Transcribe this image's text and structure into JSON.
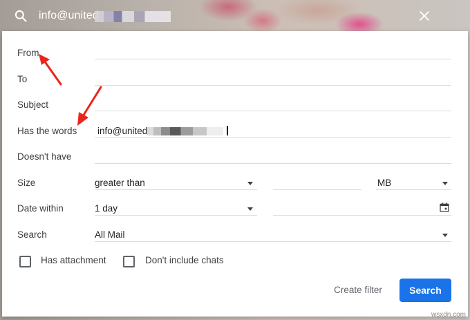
{
  "search_bar": {
    "query": "info@united",
    "icon": "search-icon",
    "close": "close-icon"
  },
  "form": {
    "from_label": "From",
    "to_label": "To",
    "subject_label": "Subject",
    "has_words_label": "Has the words",
    "has_words_value": "info@united",
    "doesnt_have_label": "Doesn't have",
    "size_label": "Size",
    "size_operator": "greater than",
    "size_unit": "MB",
    "date_label": "Date within",
    "date_value": "1 day",
    "search_label": "Search",
    "search_scope": "All Mail",
    "has_attachment_label": "Has attachment",
    "no_chats_label": "Don't include chats"
  },
  "actions": {
    "create_filter": "Create filter",
    "search": "Search"
  },
  "colors": {
    "primary": "#1a73e8",
    "annotation_arrow": "#e8261c"
  },
  "watermark": "wsxdn.com"
}
